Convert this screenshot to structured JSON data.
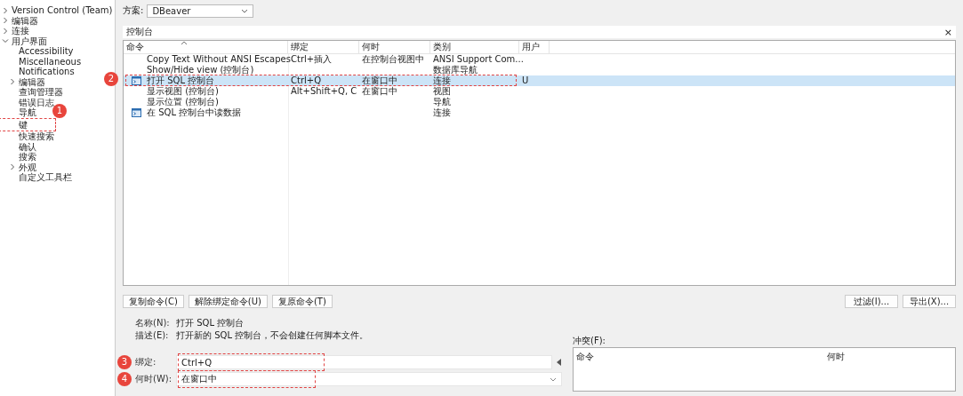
{
  "sidebar": {
    "items": [
      {
        "label": "Version Control (Team)",
        "expandable": true,
        "expanded": false
      },
      {
        "label": "编辑器",
        "expandable": true,
        "expanded": false
      },
      {
        "label": "连接",
        "expandable": true,
        "expanded": false
      },
      {
        "label": "用户界面",
        "expandable": true,
        "expanded": true,
        "children": [
          {
            "label": "Accessibility"
          },
          {
            "label": "Miscellaneous"
          },
          {
            "label": "Notifications"
          },
          {
            "label": "编辑器",
            "expandable": true,
            "expanded": false
          },
          {
            "label": "查询管理器"
          },
          {
            "label": "错误日志"
          },
          {
            "label": "导航"
          },
          {
            "label": "键",
            "callout": "1"
          },
          {
            "label": "快速搜索"
          },
          {
            "label": "确认"
          },
          {
            "label": "搜索"
          },
          {
            "label": "外观",
            "expandable": true,
            "expanded": false
          },
          {
            "label": "自定义工具栏"
          }
        ]
      }
    ]
  },
  "scheme": {
    "label": "方案:",
    "value": "DBeaver"
  },
  "filter": {
    "value": "控制台",
    "clear": "×"
  },
  "table": {
    "columns": [
      "命令",
      "绑定",
      "何时",
      "类别",
      "用户"
    ],
    "rows": [
      {
        "kind": "plain",
        "cells": [
          "Copy Text Without ANSI Escapes",
          "Ctrl+插入",
          "在控制台视图中",
          "ANSI Support Com...",
          ""
        ],
        "selected": false
      },
      {
        "kind": "plain",
        "cells": [
          "Show/Hide view (控制台)",
          "",
          "",
          "数据库导航",
          ""
        ],
        "selected": false
      },
      {
        "kind": "console",
        "cells": [
          "打开 SQL 控制台",
          "Ctrl+Q",
          "在窗口中",
          "连接",
          "U"
        ],
        "selected": true,
        "callout": "2"
      },
      {
        "kind": "plain",
        "cells": [
          "显示视图 (控制台)",
          "Alt+Shift+Q, C",
          "在窗口中",
          "视图",
          ""
        ],
        "selected": false
      },
      {
        "kind": "plain",
        "cells": [
          "显示位置 (控制台)",
          "",
          "",
          "导航",
          ""
        ],
        "selected": false
      },
      {
        "kind": "console",
        "cells": [
          "在 SQL 控制台中读数据",
          "",
          "",
          "连接",
          ""
        ],
        "selected": false
      }
    ]
  },
  "buttons_left": [
    "复制命令(C)",
    "解除绑定命令(U)",
    "复原命令(T)"
  ],
  "buttons_right": [
    "过滤(I)...",
    "导出(X)..."
  ],
  "details": {
    "name_label": "名称(N):",
    "name": "打开 SQL 控制台",
    "desc_label": "描述(E):",
    "desc": "打开新的 SQL 控制台，不会创建任何脚本文件。",
    "binding_label": "绑定:",
    "binding": "Ctrl+Q",
    "binding_callout": "3",
    "when_label": "何时(W):",
    "when": "在窗口中",
    "when_callout": "4"
  },
  "conflicts": {
    "label": "冲突(F):",
    "columns": [
      "命令",
      "何时"
    ]
  }
}
